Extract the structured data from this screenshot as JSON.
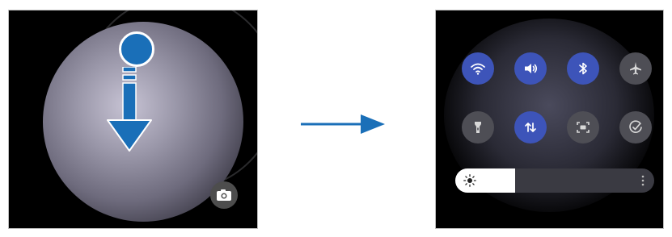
{
  "left_screen": {
    "gesture": "swipe-down",
    "camera_icon": "camera-icon"
  },
  "transition": {
    "icon": "arrow-right-icon",
    "color": "#1a6fb8"
  },
  "quick_panel": {
    "row1": [
      {
        "name": "wifi",
        "icon": "wifi-icon",
        "state": "on"
      },
      {
        "name": "sound",
        "icon": "volume-icon",
        "state": "on"
      },
      {
        "name": "bluetooth",
        "icon": "bluetooth-icon",
        "state": "on"
      },
      {
        "name": "airplane-mode",
        "icon": "airplane-icon",
        "state": "off"
      }
    ],
    "row2": [
      {
        "name": "flashlight",
        "icon": "flashlight-icon",
        "state": "off"
      },
      {
        "name": "mobile-data",
        "icon": "data-transfer-icon",
        "state": "on"
      },
      {
        "name": "screen-capture",
        "icon": "screenshot-icon",
        "state": "off"
      },
      {
        "name": "check",
        "icon": "check-circle-icon",
        "state": "off"
      }
    ],
    "brightness": {
      "level": 0.3,
      "icon": "sun-icon",
      "menu_icon": "more-vertical-icon"
    },
    "colors": {
      "on": "#3d54b9",
      "off": "#4e4e55"
    }
  }
}
